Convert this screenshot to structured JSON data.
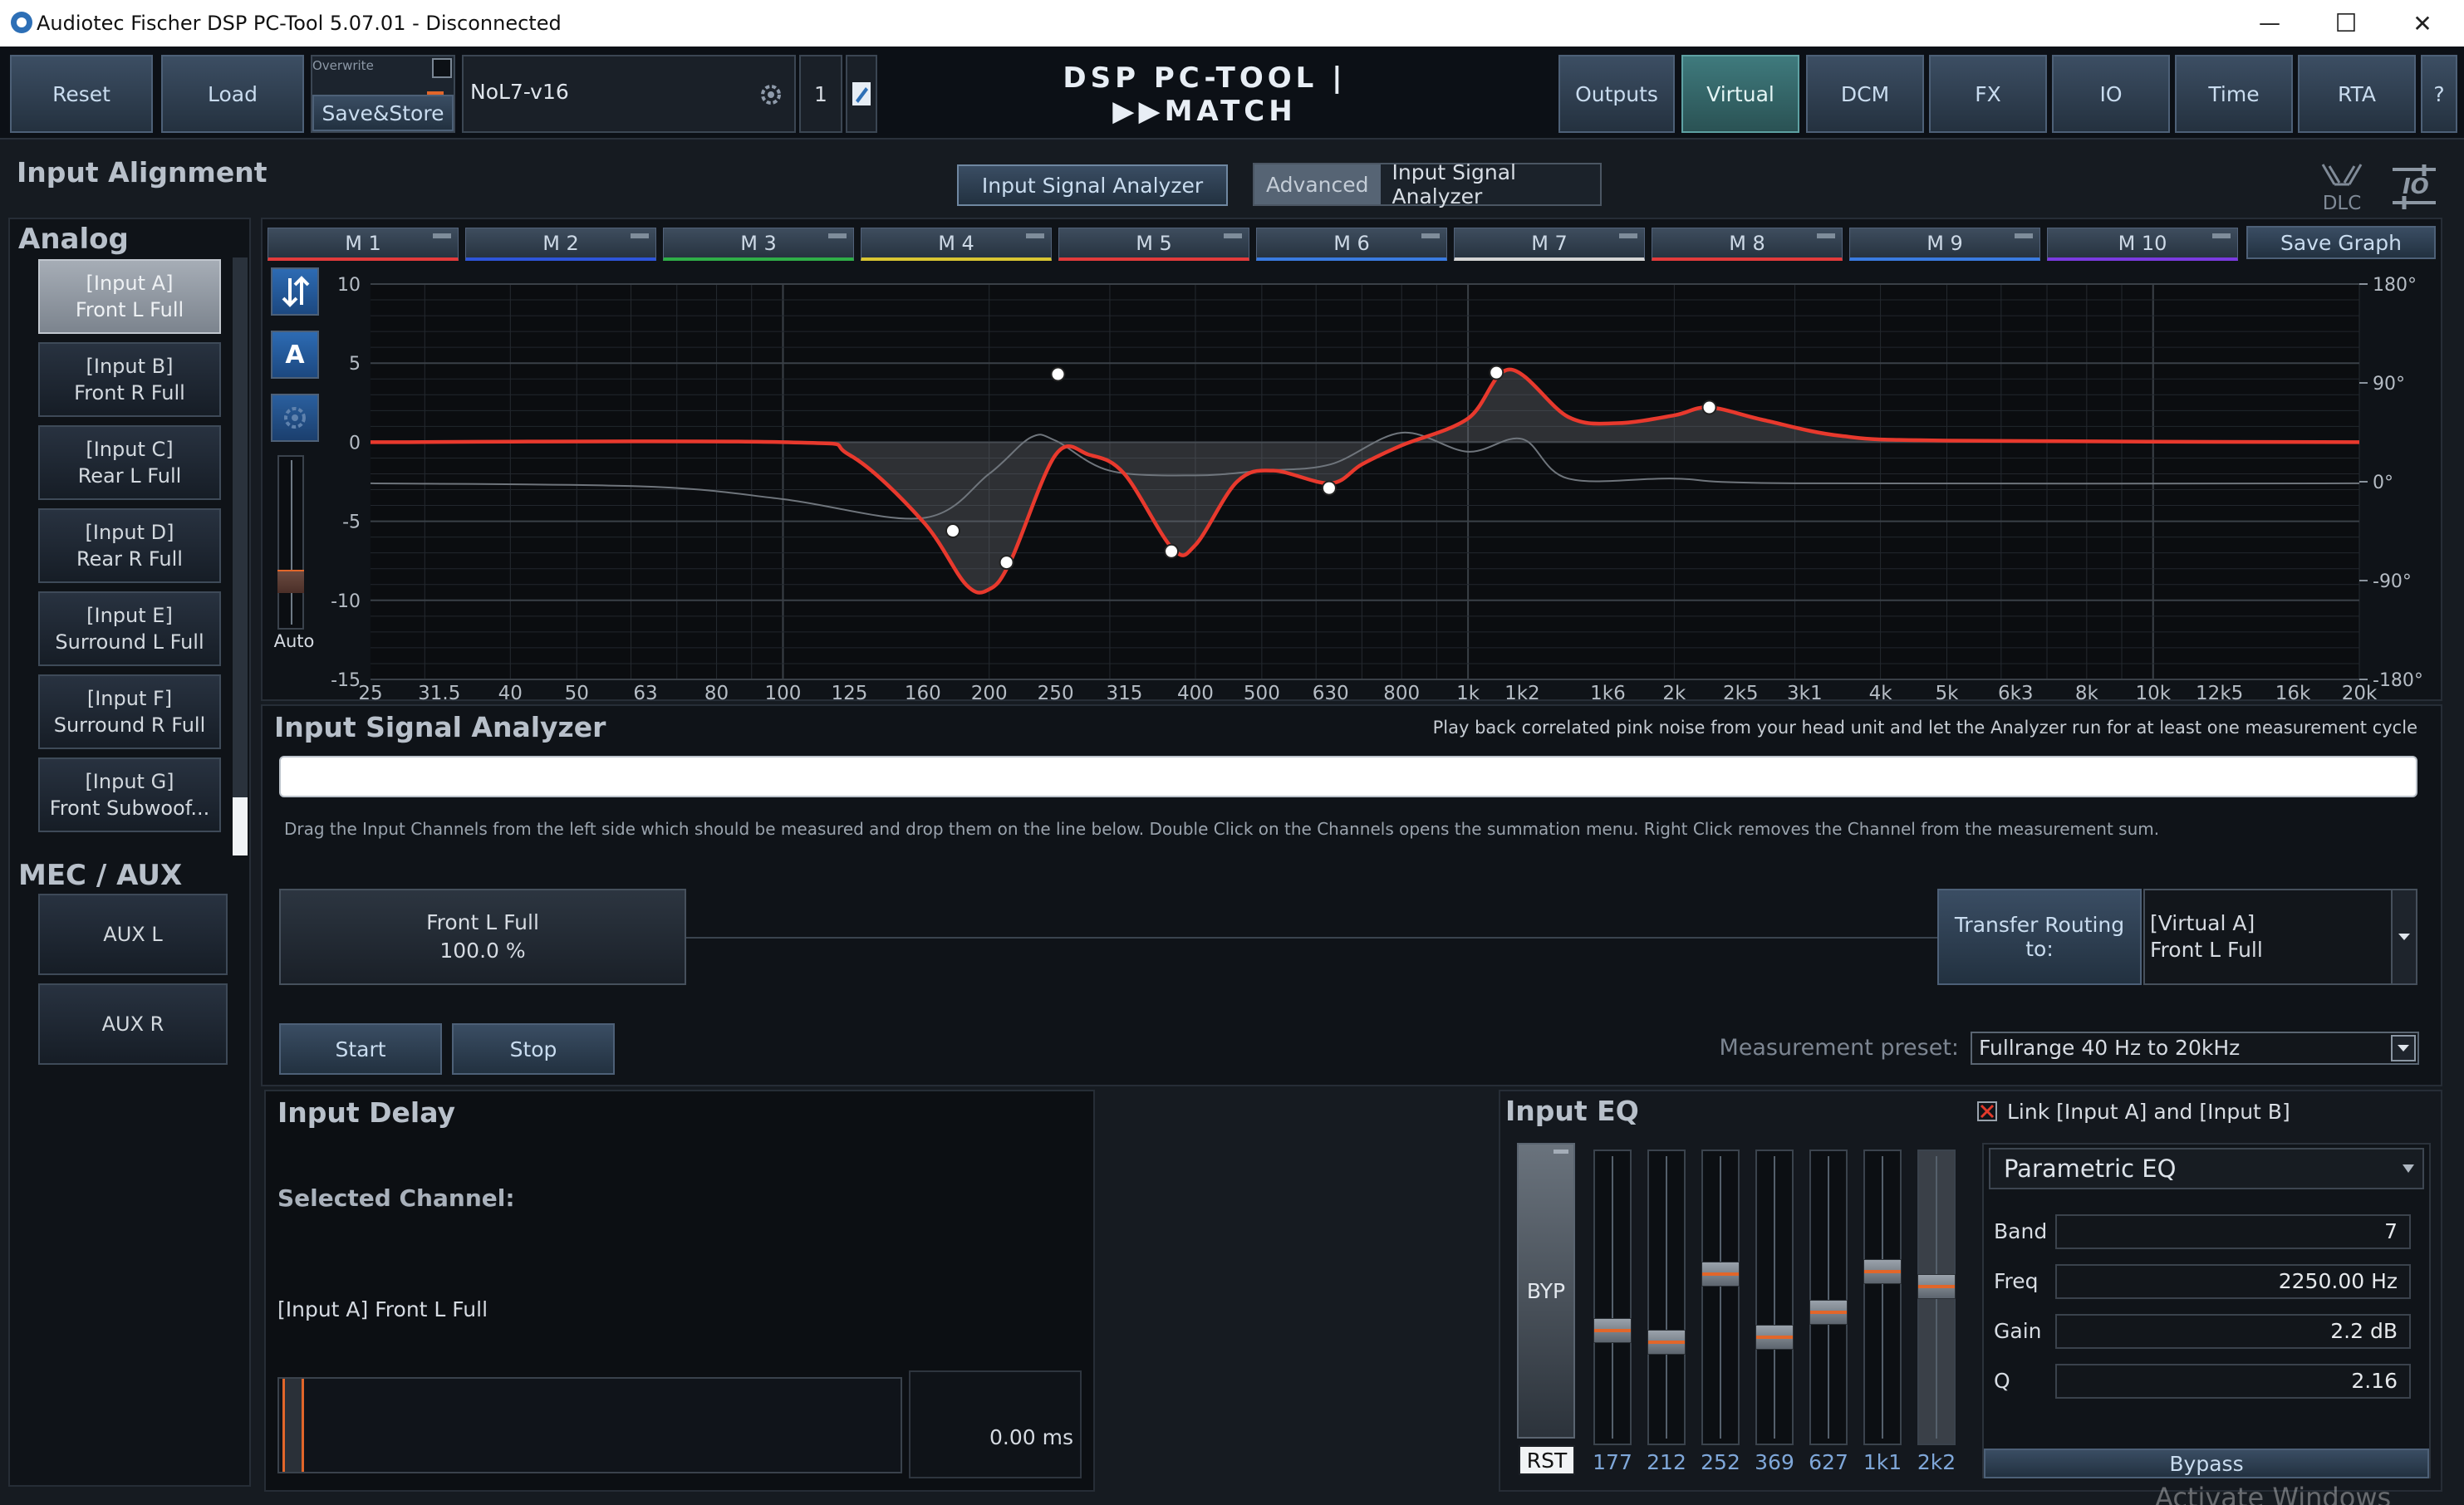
{
  "window": {
    "title": "Audiotec Fischer DSP PC-Tool 5.07.01 - Disconnected",
    "minimize_glyph": "—",
    "maximize_glyph": "☐",
    "close_glyph": "✕"
  },
  "toolbar": {
    "reset": "Reset",
    "load": "Load",
    "overwrite_label": "Overwrite",
    "save_store": "Save&Store",
    "preset_name": "NoL7-v16",
    "preset_number": "1",
    "logo_text": "DSP PC-TOOL | ▶▶MATCH",
    "outputs": "Outputs",
    "virtual": "Virtual",
    "dcm": "DCM",
    "fx": "FX",
    "io": "IO",
    "time": "Time",
    "rta": "RTA",
    "help": "?"
  },
  "page": {
    "title": "Input Alignment",
    "analyzer_button": "Input Signal Analyzer",
    "advanced_label": "Advanced",
    "advanced_analyzer": "Input Signal Analyzer",
    "dlc_label": "DLC",
    "io_label": "IO"
  },
  "sidebar": {
    "analog_title": "Analog",
    "analog": [
      {
        "line1": "[Input A]",
        "line2": "Front L Full"
      },
      {
        "line1": "[Input B]",
        "line2": "Front R Full"
      },
      {
        "line1": "[Input C]",
        "line2": "Rear L Full"
      },
      {
        "line1": "[Input D]",
        "line2": "Rear R Full"
      },
      {
        "line1": "[Input E]",
        "line2": "Surround L Full"
      },
      {
        "line1": "[Input F]",
        "line2": "Surround R Full"
      },
      {
        "line1": "[Input G]",
        "line2": "Front Subwoof..."
      }
    ],
    "mec_title": "MEC / AUX",
    "aux": [
      "AUX L",
      "AUX R"
    ]
  },
  "graph": {
    "tabs": [
      "M 1",
      "M 2",
      "M 3",
      "M 4",
      "M 5",
      "M 6",
      "M 7",
      "M 8",
      "M 9",
      "M 10"
    ],
    "tab_colors": [
      "#e23b3b",
      "#2e55d9",
      "#2fae48",
      "#d9c632",
      "#e23b3b",
      "#3a7be0",
      "#d4d4d4",
      "#e23b3b",
      "#3a7be0",
      "#7a3be0"
    ],
    "save_graph": "Save Graph",
    "a_button": "A",
    "auto_label": "Auto",
    "curve_color": "#e8392d"
  },
  "chart_data": {
    "type": "line",
    "x_ticks": [
      "25",
      "31.5",
      "40",
      "50",
      "63",
      "80",
      "100",
      "125",
      "160",
      "200",
      "250",
      "315",
      "400",
      "500",
      "630",
      "800",
      "1k",
      "1k2",
      "1k6",
      "2k",
      "2k5",
      "3k1",
      "4k",
      "5k",
      "6k3",
      "8k",
      "10k",
      "12k5",
      "16k",
      "20k"
    ],
    "y_ticks": [
      "10",
      "5",
      "0",
      "-5",
      "-10",
      "-15"
    ],
    "y2_ticks": [
      "180°",
      "90°",
      "0°",
      "-90°",
      "-180°"
    ],
    "ylim": [
      -15,
      10
    ],
    "series": [
      {
        "values": [
          [
            25,
            0
          ],
          [
            100,
            0
          ],
          [
            125,
            -0.8
          ],
          [
            160,
            -5
          ],
          [
            185,
            -9
          ],
          [
            200,
            -9.3
          ],
          [
            215,
            -7.5
          ],
          [
            250,
            -0.8
          ],
          [
            280,
            -0.8
          ],
          [
            315,
            -2
          ],
          [
            370,
            -6.7
          ],
          [
            400,
            -6.5
          ],
          [
            460,
            -2.5
          ],
          [
            520,
            -1.8
          ],
          [
            630,
            -2.6
          ],
          [
            700,
            -1.4
          ],
          [
            800,
            -0.2
          ],
          [
            1000,
            1.5
          ],
          [
            1150,
            4.6
          ],
          [
            1400,
            1.6
          ],
          [
            1650,
            1.2
          ],
          [
            2000,
            1.7
          ],
          [
            2250,
            2.2
          ],
          [
            2700,
            1.4
          ],
          [
            3500,
            0.4
          ],
          [
            5000,
            0.1
          ],
          [
            20000,
            0
          ]
        ]
      },
      {
        "values": [
          [
            25,
            -2.6
          ],
          [
            63,
            -2.8
          ],
          [
            100,
            -3.6
          ],
          [
            160,
            -4.8
          ],
          [
            200,
            -2
          ],
          [
            230,
            0.3
          ],
          [
            250,
            0.1
          ],
          [
            300,
            -1.8
          ],
          [
            400,
            -2.1
          ],
          [
            500,
            -1.8
          ],
          [
            630,
            -1.4
          ],
          [
            800,
            0.6
          ],
          [
            1000,
            -0.6
          ],
          [
            1200,
            0.2
          ],
          [
            1400,
            -2.3
          ],
          [
            2000,
            -2.3
          ],
          [
            3000,
            -2.6
          ],
          [
            20000,
            -2.6
          ]
        ]
      }
    ],
    "band_points": [
      [
        177,
        -5.6
      ],
      [
        212,
        -7.6
      ],
      [
        252,
        4.3
      ],
      [
        369,
        -6.9
      ],
      [
        627,
        -2.9
      ],
      [
        1100,
        4.4
      ],
      [
        2250,
        2.2
      ]
    ]
  },
  "analyzer": {
    "title": "Input Signal Analyzer",
    "hint": "Play back correlated pink noise from your head unit and let the Analyzer run for at least one measurement cycle",
    "drag_hint": "Drag the Input Channels from the left side which should be measured and drop them on the line below. Double Click on the Channels opens the summation menu. Right Click removes the Channel from the measurement sum.",
    "channel_name": "Front L Full",
    "channel_pct": "100.0 %",
    "transfer_label": "Transfer Routing to:",
    "target_line1": "[Virtual A]",
    "target_line2": "Front L Full",
    "start": "Start",
    "stop": "Stop",
    "preset_label": "Measurement preset:",
    "preset_value": "Fullrange 40 Hz to 20kHz"
  },
  "delay": {
    "title": "Input Delay",
    "selected_label": "Selected Channel:",
    "selected_value": "[Input A] Front L Full",
    "value": "0.00 ms"
  },
  "eq": {
    "title": "Input EQ",
    "link_label": "Link [Input A] and [Input B]",
    "byp": "BYP",
    "rst": "RST",
    "band_freqs": [
      "177",
      "212",
      "252",
      "369",
      "627",
      "1k1",
      "2k2"
    ],
    "band_gains": [
      -2.8,
      -3.8,
      2.2,
      -3.4,
      -1.2,
      2.4,
      1.1
    ],
    "type": "Parametric EQ",
    "band_label": "Band",
    "band_value": "7",
    "freq_label": "Freq",
    "freq_value": "2250.00 Hz",
    "gain_label": "Gain",
    "gain_value": "2.2 dB",
    "q_label": "Q",
    "q_value": "2.16",
    "bypass": "Bypass"
  },
  "overlay": {
    "watermark": "Activate Windows"
  }
}
